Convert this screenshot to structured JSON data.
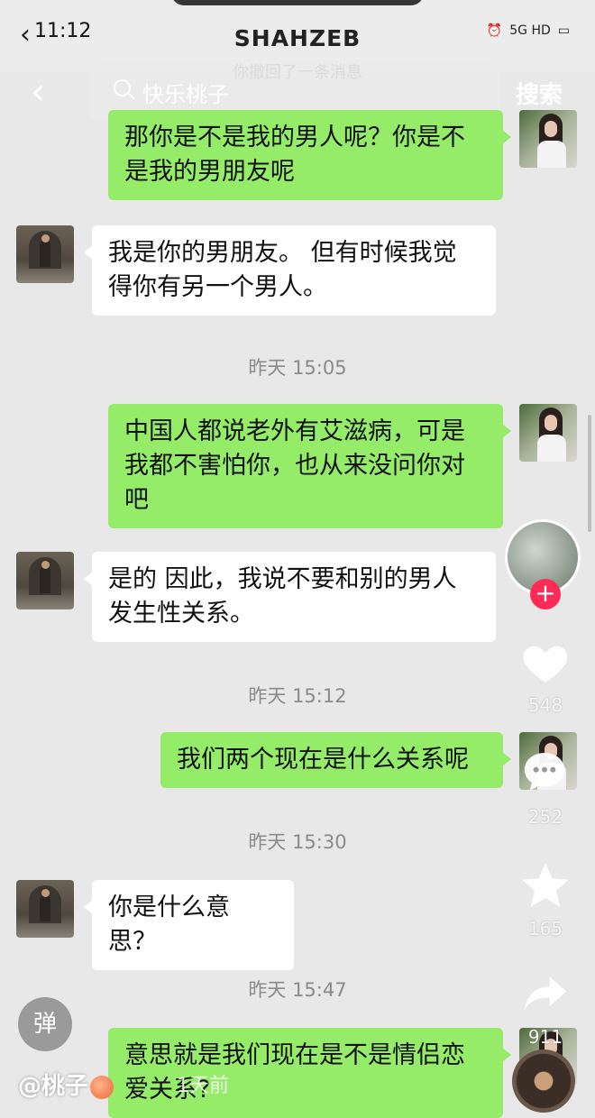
{
  "status_bar": {
    "time": "11:12",
    "contact_name": "SHAHZEB",
    "network": "5G HD",
    "recall_hint": "你撤回了一条消息"
  },
  "search": {
    "query": "快乐桃子",
    "button_label": "搜索"
  },
  "messages": [
    {
      "from": "me",
      "text": "那你是不是我的男人呢？你是不是我的男朋友呢"
    },
    {
      "from": "them",
      "text": "我是你的男朋友。 但有时候我觉得你有另一个男人。"
    },
    {
      "timestamp": "昨天 15:05"
    },
    {
      "from": "me",
      "text": "中国人都说老外有艾滋病，可是我都不害怕你，也从来没问你对吧"
    },
    {
      "from": "them",
      "text": "是的 因此，我说不要和别的男人发生性关系。"
    },
    {
      "timestamp": "昨天 15:12"
    },
    {
      "from": "me",
      "text": "我们两个现在是什么关系呢"
    },
    {
      "timestamp": "昨天 15:30"
    },
    {
      "from": "them",
      "text": "你是什么意思？"
    },
    {
      "timestamp": "昨天 15:47"
    },
    {
      "from": "me",
      "text": "意思就是我们现在是不是情侣恋爱关系?"
    }
  ],
  "side_actions": {
    "likes": "548",
    "comments": "252",
    "favorites": "165",
    "shares": "911"
  },
  "bottom": {
    "barrage_label": "弹",
    "author": "@桃子",
    "time_ago": "1天前"
  },
  "icons": {
    "back": "chevron-left-icon",
    "search": "search-icon",
    "heart": "heart-icon",
    "comment": "comment-icon",
    "star": "star-icon",
    "share": "share-icon"
  },
  "colors": {
    "my_bubble": "#95ec69",
    "their_bubble": "#ffffff",
    "follow_plus": "#fe2c55"
  }
}
